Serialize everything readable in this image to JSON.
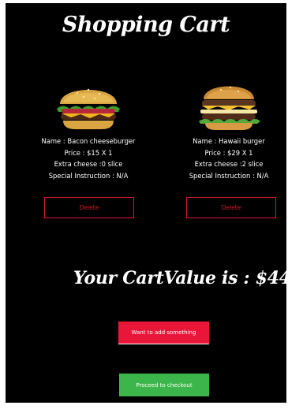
{
  "header": {
    "title": "Shopping Cart"
  },
  "items": [
    {
      "name": "Name : Bacon cheeseburger",
      "price": "Price : $15 X 1",
      "extra": "Extra cheese :0 slice",
      "instruction": "Special Instruction : N/A",
      "delete_label": "Delete",
      "image_icon": "burger-image"
    },
    {
      "name": "Name : Hawaii burger",
      "price": "Price : $29 X 1",
      "extra": "Extra cheese :2 slice",
      "instruction": "Special Instruction : N/A",
      "delete_label": "Delete",
      "image_icon": "burger-image"
    }
  ],
  "summary": {
    "cart_value_text": "Your CartValue is : $44"
  },
  "actions": {
    "add_label": "Want to add something",
    "checkout_label": "Proceed to checkout"
  },
  "colors": {
    "background": "#000000",
    "delete": "#d61a2c",
    "add_button": "#e8173a",
    "checkout_button": "#3cb64a",
    "text": "#ffffff"
  }
}
